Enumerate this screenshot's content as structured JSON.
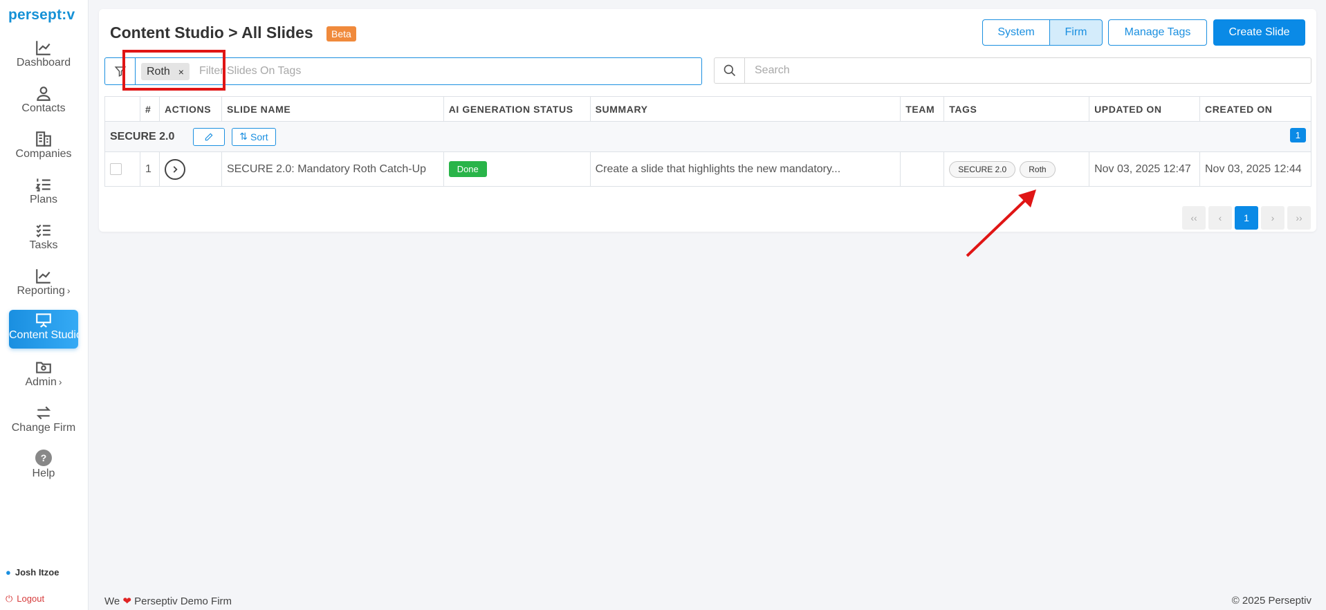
{
  "brand": {
    "logo": "persept:v"
  },
  "sidebar": {
    "items": [
      {
        "label": "Dashboard",
        "icon": "chart-line-icon"
      },
      {
        "label": "Contacts",
        "icon": "user-icon"
      },
      {
        "label": "Companies",
        "icon": "buildings-icon"
      },
      {
        "label": "Plans",
        "icon": "numbered-list-icon"
      },
      {
        "label": "Tasks",
        "icon": "checklist-icon"
      },
      {
        "label": "Reporting",
        "icon": "chart-line-icon",
        "has_submenu": true
      },
      {
        "label": "Content Studio",
        "icon": "presentation-icon",
        "active": true
      },
      {
        "label": "Admin",
        "icon": "folder-gear-icon",
        "has_submenu": true
      },
      {
        "label": "Change Firm",
        "icon": "swap-arrows-icon"
      },
      {
        "label": "Help",
        "icon": "help-circle-icon"
      }
    ],
    "help_glyph": "?",
    "chevron": "›",
    "user_name": "Josh Itzoe",
    "logout_label": "Logout"
  },
  "header": {
    "title": "Content Studio > All Slides",
    "badge": "Beta",
    "segment": {
      "system": "System",
      "firm": "Firm",
      "selected": "Firm"
    },
    "manage_tags": "Manage Tags",
    "create_slide": "Create Slide"
  },
  "filter": {
    "chip": "Roth",
    "chip_remove": "×",
    "placeholder": "Filter Slides On Tags"
  },
  "search": {
    "placeholder": "Search"
  },
  "table": {
    "columns": [
      "",
      "#",
      "ACTIONS",
      "SLIDE NAME",
      "AI GENERATION STATUS",
      "SUMMARY",
      "TEAM",
      "TAGS",
      "UPDATED ON",
      "CREATED ON"
    ],
    "group": {
      "name": "SECURE 2.0",
      "sort_label": "Sort",
      "count": "1"
    },
    "rows": [
      {
        "num": "1",
        "slide_name": "SECURE 2.0: Mandatory Roth Catch-Up",
        "status": "Done",
        "summary": "Create a slide that highlights the new mandatory...",
        "team": "",
        "tags": [
          "SECURE 2.0",
          "Roth"
        ],
        "updated_on": "Nov 03, 2025 12:47",
        "created_on": "Nov 03, 2025 12:44"
      }
    ]
  },
  "pagination": {
    "first": "‹‹",
    "prev": "‹",
    "current": "1",
    "next": "›",
    "last": "››"
  },
  "footer": {
    "we": "We",
    "heart": "❤",
    "firm": "Perseptiv Demo Firm",
    "copyright": "© 2025 Perseptiv"
  },
  "colors": {
    "accent": "#0a8ae6",
    "beta": "#f08a3c",
    "done": "#29b449",
    "highlight": "#e01515"
  }
}
